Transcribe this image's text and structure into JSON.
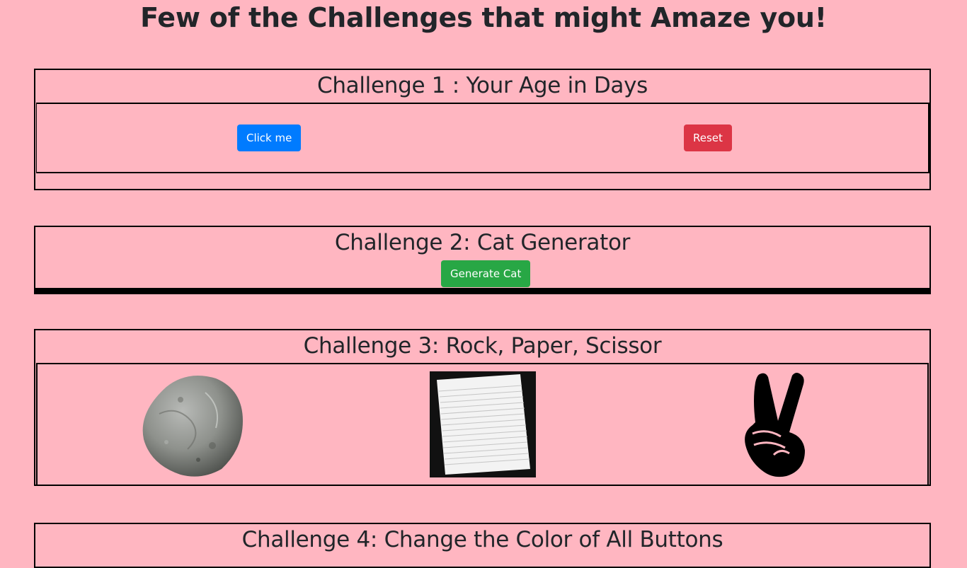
{
  "page": {
    "title": "Few of the Challenges that might Amaze you!"
  },
  "challenge1": {
    "heading": "Challenge 1 : Your Age in Days",
    "click_label": "Click me",
    "reset_label": "Reset"
  },
  "challenge2": {
    "heading": "Challenge 2: Cat Generator",
    "generate_label": "Generate Cat"
  },
  "challenge3": {
    "heading": "Challenge 3: Rock, Paper, Scissor",
    "choices": [
      "rock-icon",
      "paper-icon",
      "scissors-icon"
    ]
  },
  "challenge4": {
    "heading": "Challenge 4: Change the Color of All Buttons"
  },
  "colors": {
    "background": "#ffb6c1",
    "primary": "#007bff",
    "danger": "#dc3545",
    "success": "#28a745"
  }
}
